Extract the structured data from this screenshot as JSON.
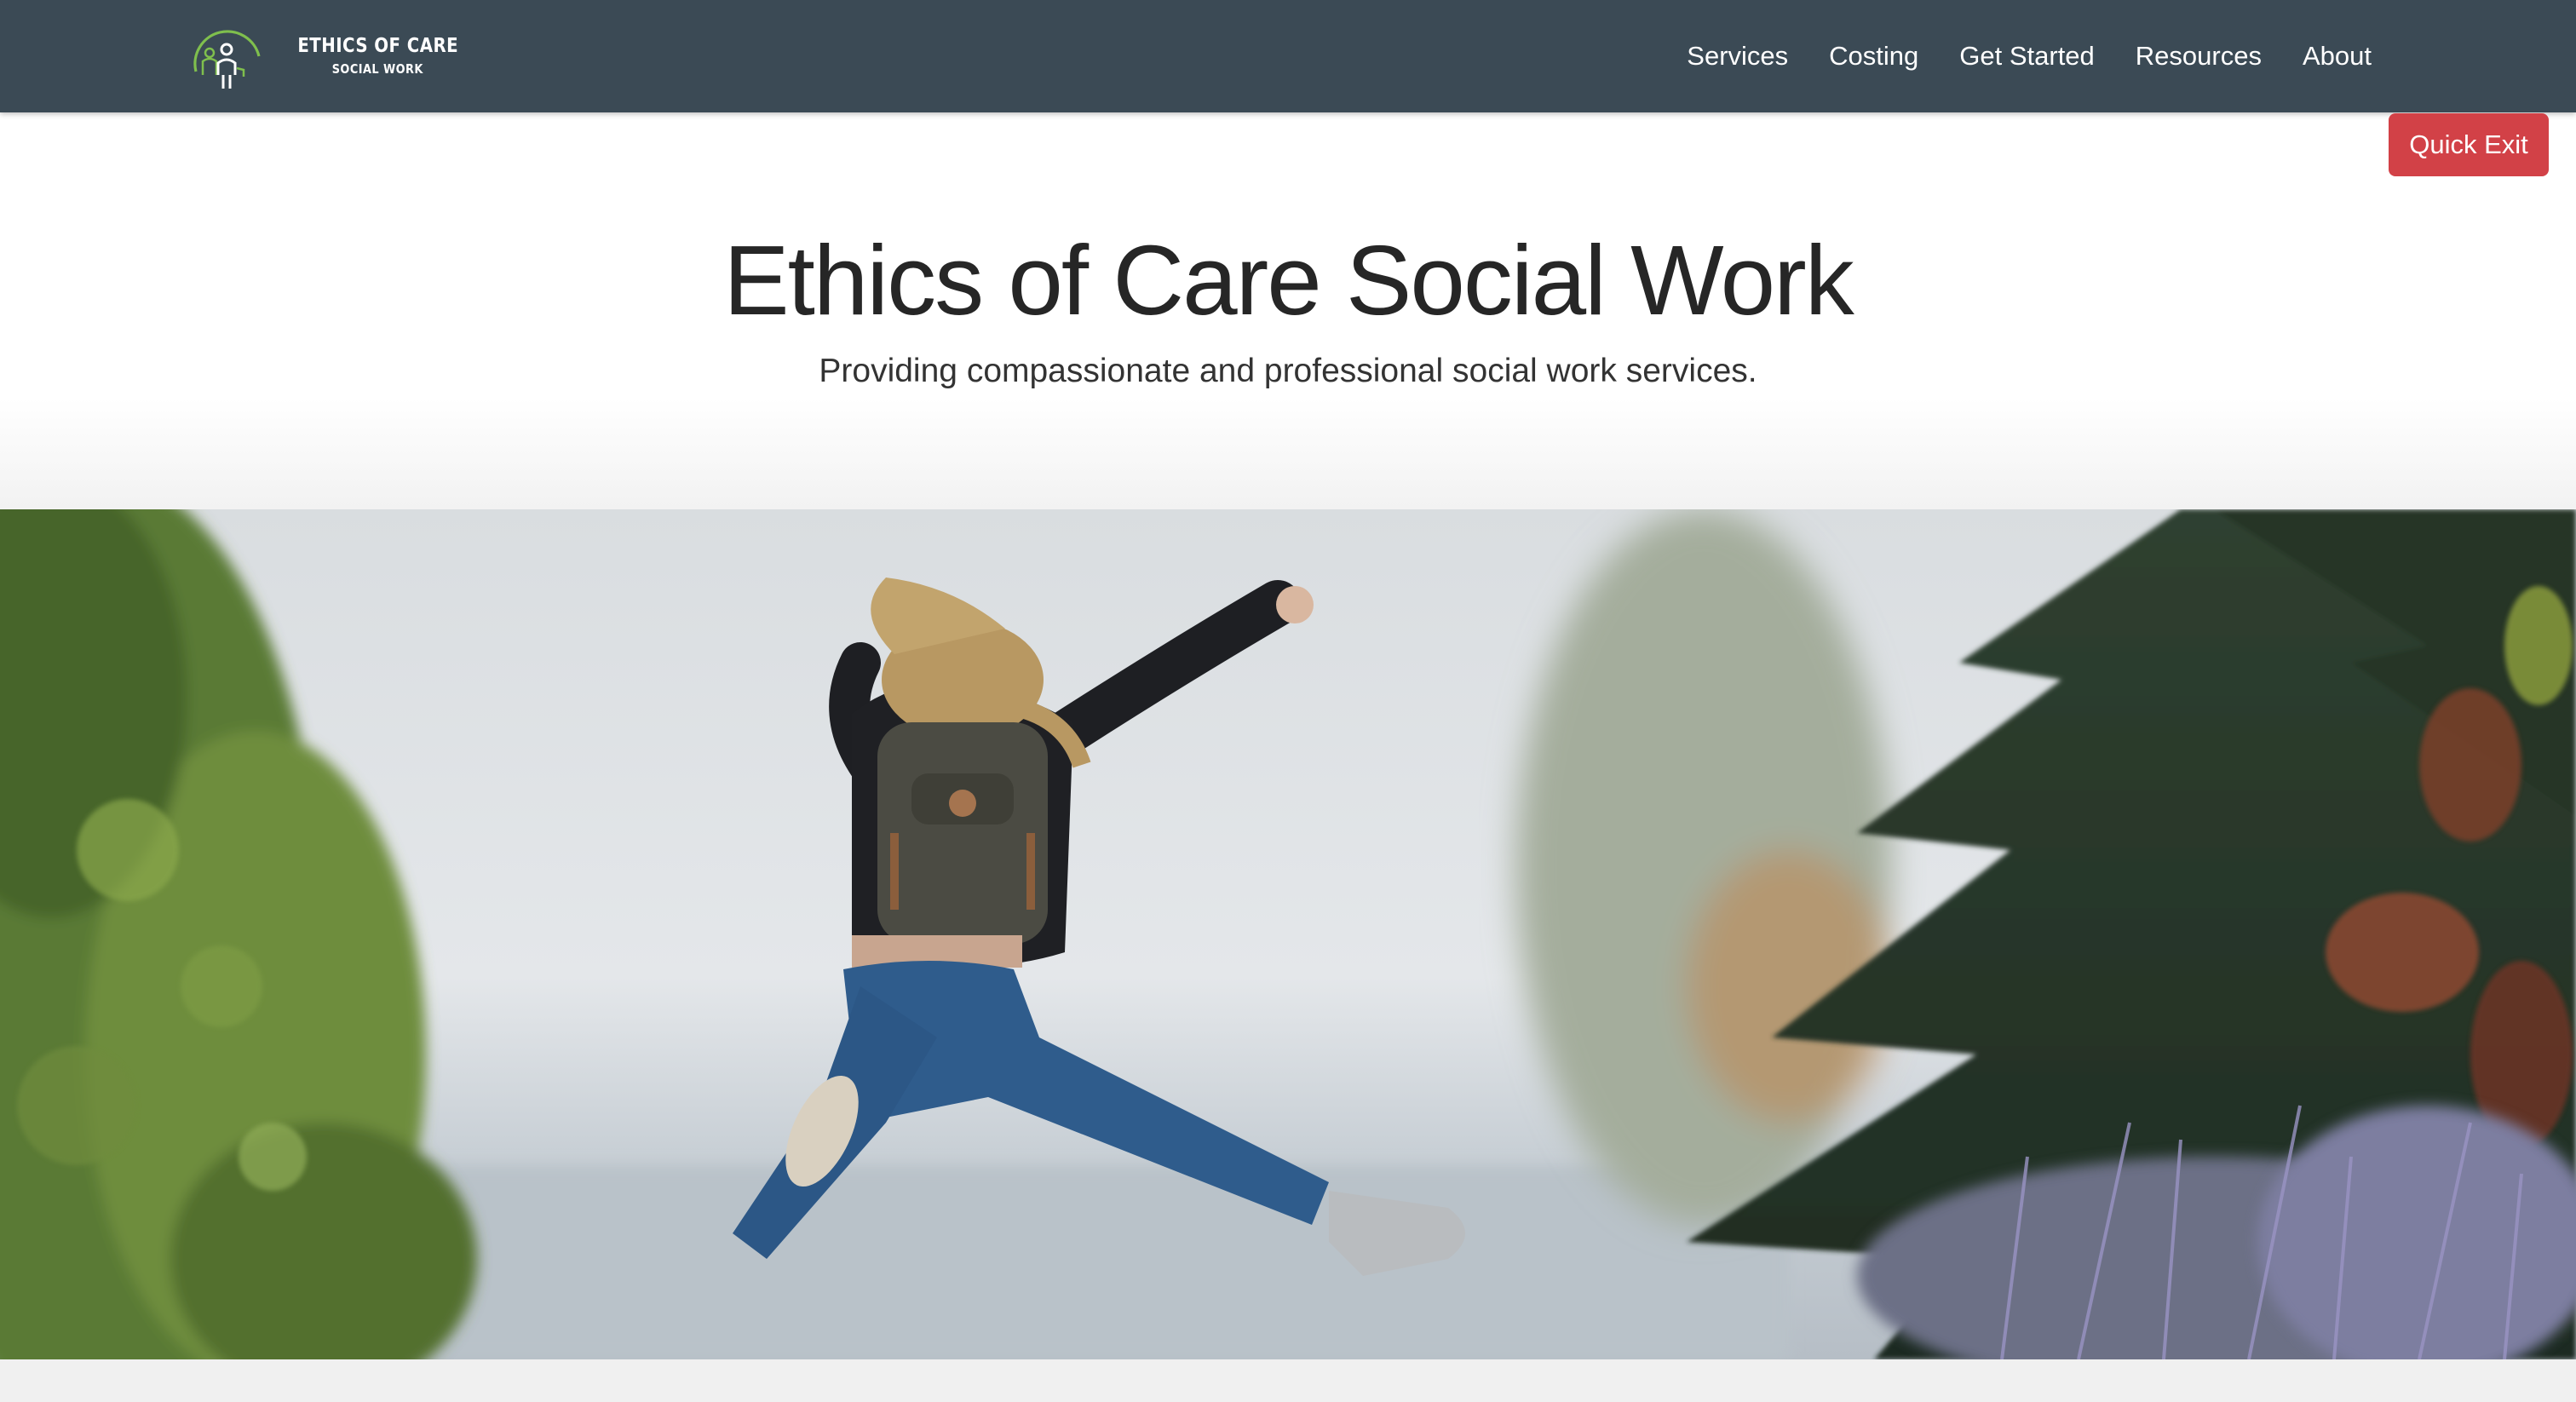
{
  "brand": {
    "line1": "ETHICS OF CARE",
    "line2": "SOCIAL WORK",
    "logo_icon": "figure-in-arc-icon",
    "colors": {
      "arc": "#7fbf4d",
      "figure": "#ffffff"
    }
  },
  "nav": {
    "items": [
      {
        "label": "Services"
      },
      {
        "label": "Costing"
      },
      {
        "label": "Get Started"
      },
      {
        "label": "Resources"
      },
      {
        "label": "About"
      }
    ]
  },
  "quick_exit": {
    "label": "Quick Exit",
    "color": "#d24147"
  },
  "hero": {
    "title": "Ethics of Care Social Work",
    "tagline": "Providing compassionate and professional social work services.",
    "image_subject": "person-jumping-photo"
  },
  "colors": {
    "navbar": "#3b4a55",
    "title_text": "#262626"
  }
}
